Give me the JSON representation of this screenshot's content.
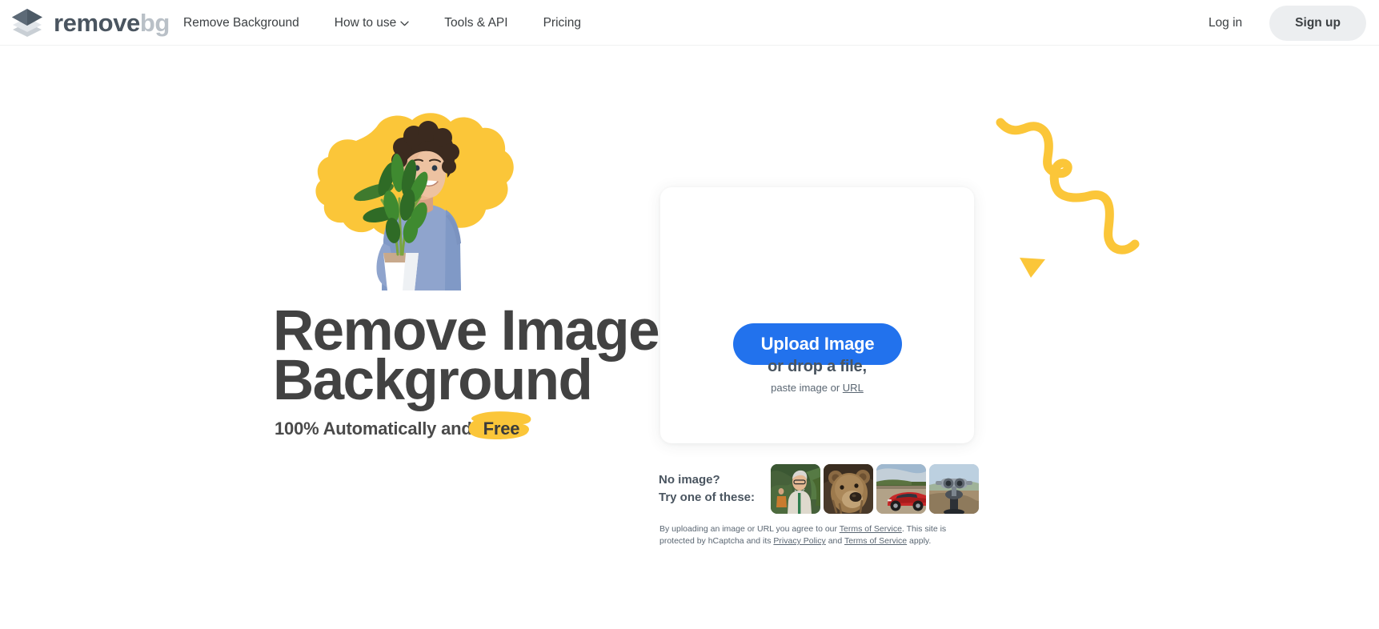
{
  "header": {
    "logo": {
      "icon": "layers-diamond-icon",
      "text_dark": "remove",
      "text_light": "bg"
    },
    "nav": [
      {
        "label": "Remove Background",
        "has_chevron": false,
        "name": "nav-remove-background"
      },
      {
        "label": "How to use",
        "has_chevron": true,
        "name": "nav-how-to-use"
      },
      {
        "label": "Tools & API",
        "has_chevron": false,
        "name": "nav-tools-api"
      },
      {
        "label": "Pricing",
        "has_chevron": false,
        "name": "nav-pricing"
      }
    ],
    "login_label": "Log in",
    "signup_label": "Sign up"
  },
  "hero": {
    "heading_line1": "Remove Image",
    "heading_line2": "Background",
    "subheading_prefix": "100% Automatically and",
    "subheading_highlight": "Free",
    "art_alt": "man in blue t-shirt holding a potted plant on yellow blob"
  },
  "upload": {
    "button_label": "Upload Image",
    "drop_label": "or drop a file,",
    "paste_prefix": "paste image or",
    "paste_link": "URL"
  },
  "samples": {
    "label_line1": "No image?",
    "label_line2": "Try one of these:",
    "items": [
      {
        "name": "sample-thumbnail-man-greenery",
        "alt": "smiling older man with glasses in greenery"
      },
      {
        "name": "sample-thumbnail-bear",
        "alt": "brown grizzly bear portrait"
      },
      {
        "name": "sample-thumbnail-car",
        "alt": "red sports car on a road"
      },
      {
        "name": "sample-thumbnail-viewfinder",
        "alt": "coin operated viewfinder binoculars"
      }
    ]
  },
  "legal": {
    "part1": "By uploading an image or URL you agree to our ",
    "link1": "Terms of Service",
    "part2": ". This site is protected by hCaptcha and its ",
    "link2": "Privacy Policy",
    "part3": " and ",
    "link3": "Terms of Service",
    "part4": " apply."
  },
  "colors": {
    "accent_blue": "#2272ed",
    "accent_yellow": "#fbc639",
    "text_dark": "#424242",
    "text_slate": "#4a5560",
    "logo_light": "#b9c0c7",
    "signup_bg": "#eceef0"
  }
}
